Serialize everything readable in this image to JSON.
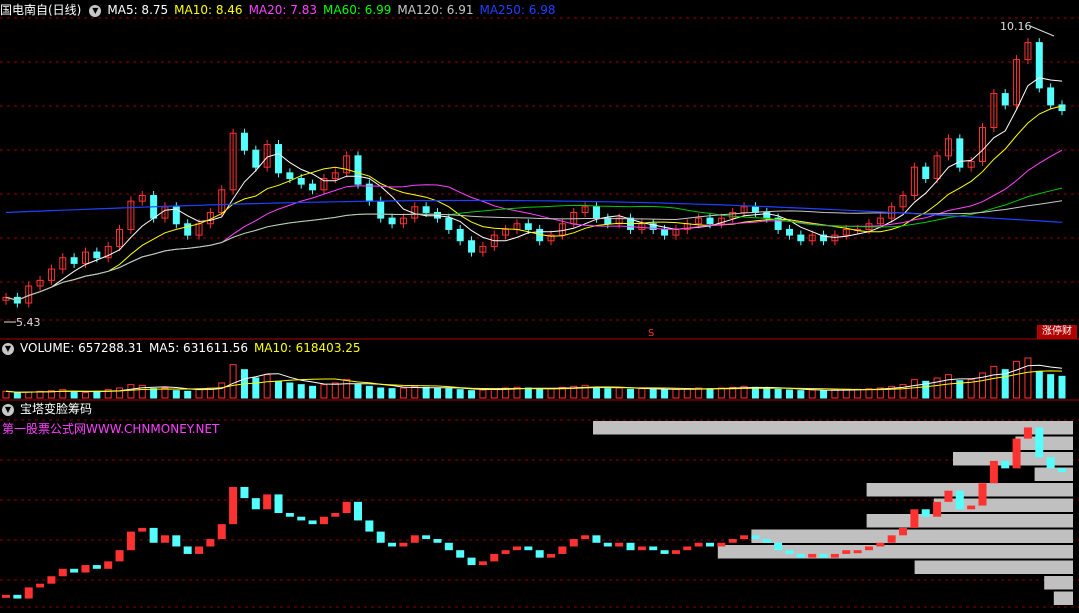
{
  "header": {
    "title": "国电南自(日线)",
    "items": [
      {
        "label": "MA5: 8.75",
        "color": "#ffffff"
      },
      {
        "label": "MA10: 8.46",
        "color": "#ffff00"
      },
      {
        "label": "MA20: 7.83",
        "color": "#ff40ff"
      },
      {
        "label": "MA60: 6.99",
        "color": "#00ff00"
      },
      {
        "label": "MA120: 6.91",
        "color": "#c8c8c8"
      },
      {
        "label": "MA250: 6.98",
        "color": "#2040ff"
      }
    ]
  },
  "volume_header": {
    "items": [
      {
        "label": "VOLUME: 657288.31",
        "color": "#ffffff"
      },
      {
        "label": "MA5: 631611.56",
        "color": "#ffffff"
      },
      {
        "label": "MA10: 618403.25",
        "color": "#ffff00"
      }
    ]
  },
  "indicator_header": {
    "title": "宝塔变脸筹码"
  },
  "watermark": "第一股票公式网WWW.CHNMONEY.NET",
  "badge": "涨停财",
  "price_labels": {
    "high": "10.16",
    "low": "5.43"
  },
  "colors": {
    "up": "#ff3232",
    "down": "#54ffff",
    "ma250": "#2040ff",
    "ma60": "#00cc00",
    "ma20": "#ff40ff",
    "grid": "#8b0000"
  },
  "chart_data": [
    {
      "type": "candlestick",
      "title": "国电南自(日线)",
      "description_values": {
        "MA5": 8.75,
        "MA10": 8.46,
        "MA20": 7.83,
        "MA60": 6.99,
        "MA120": 6.91,
        "MA250": 6.98
      },
      "ylim": [
        5.2,
        10.5
      ],
      "high": 10.16,
      "low": 5.43,
      "close_series": [
        5.6,
        5.5,
        5.8,
        5.9,
        6.1,
        6.3,
        6.2,
        6.4,
        6.3,
        6.5,
        6.8,
        7.3,
        7.4,
        7.0,
        7.2,
        6.9,
        6.7,
        6.9,
        7.1,
        7.5,
        8.5,
        8.2,
        7.9,
        8.3,
        7.8,
        7.7,
        7.6,
        7.5,
        7.7,
        7.8,
        8.1,
        7.6,
        7.3,
        7.0,
        6.9,
        7.0,
        7.2,
        7.1,
        7.0,
        6.8,
        6.6,
        6.4,
        6.5,
        6.7,
        6.8,
        6.9,
        6.8,
        6.6,
        6.7,
        6.9,
        7.1,
        7.2,
        7.0,
        6.9,
        7.0,
        6.8,
        6.9,
        6.8,
        6.7,
        6.8,
        6.9,
        7.0,
        6.9,
        7.0,
        7.1,
        7.2,
        7.1,
        7.0,
        6.8,
        6.7,
        6.6,
        6.7,
        6.6,
        6.7,
        6.8,
        6.8,
        6.9,
        7.0,
        7.2,
        7.4,
        7.9,
        7.7,
        8.1,
        8.4,
        7.9,
        8.0,
        8.6,
        9.2,
        9.0,
        9.8,
        10.1,
        9.3,
        9.0,
        8.9
      ]
    },
    {
      "type": "bar",
      "title": "VOLUME",
      "values": [
        20,
        15,
        18,
        20,
        22,
        25,
        18,
        16,
        20,
        25,
        30,
        40,
        38,
        28,
        30,
        22,
        20,
        26,
        30,
        45,
        100,
        85,
        60,
        70,
        50,
        45,
        40,
        35,
        40,
        45,
        55,
        40,
        35,
        30,
        28,
        30,
        35,
        32,
        30,
        28,
        25,
        22,
        24,
        28,
        30,
        32,
        30,
        26,
        28,
        32,
        35,
        38,
        32,
        28,
        30,
        26,
        28,
        26,
        24,
        26,
        28,
        30,
        28,
        30,
        32,
        35,
        32,
        30,
        26,
        24,
        22,
        24,
        22,
        24,
        26,
        26,
        28,
        30,
        35,
        40,
        55,
        50,
        60,
        70,
        52,
        55,
        75,
        95,
        85,
        110,
        120,
        80,
        70,
        65
      ]
    },
    {
      "type": "bar",
      "title": "宝塔变脸筹码",
      "values": [
        5.6,
        5.5,
        5.8,
        5.9,
        6.1,
        6.3,
        6.2,
        6.4,
        6.3,
        6.5,
        6.8,
        7.3,
        7.4,
        7.0,
        7.2,
        6.9,
        6.7,
        6.9,
        7.1,
        7.5,
        8.5,
        8.2,
        7.9,
        8.3,
        7.8,
        7.7,
        7.6,
        7.5,
        7.7,
        7.8,
        8.1,
        7.6,
        7.3,
        7.0,
        6.9,
        7.0,
        7.2,
        7.1,
        7.0,
        6.8,
        6.6,
        6.4,
        6.5,
        6.7,
        6.8,
        6.9,
        6.8,
        6.6,
        6.7,
        6.9,
        7.1,
        7.2,
        7.0,
        6.9,
        7.0,
        6.8,
        6.9,
        6.8,
        6.7,
        6.8,
        6.9,
        7.0,
        6.9,
        7.0,
        7.1,
        7.2,
        7.1,
        7.0,
        6.8,
        6.7,
        6.6,
        6.7,
        6.6,
        6.7,
        6.8,
        6.8,
        6.9,
        7.0,
        7.2,
        7.4,
        7.9,
        7.7,
        8.1,
        8.4,
        7.9,
        8.0,
        8.6,
        9.2,
        9.0,
        9.8,
        10.1,
        9.3,
        9.0,
        8.9
      ],
      "chip_bars": [
        1.0,
        0.12,
        0.25,
        0.08,
        0.43,
        0.29,
        0.43,
        0.67,
        0.74,
        0.33,
        0.06,
        0.04
      ]
    }
  ]
}
